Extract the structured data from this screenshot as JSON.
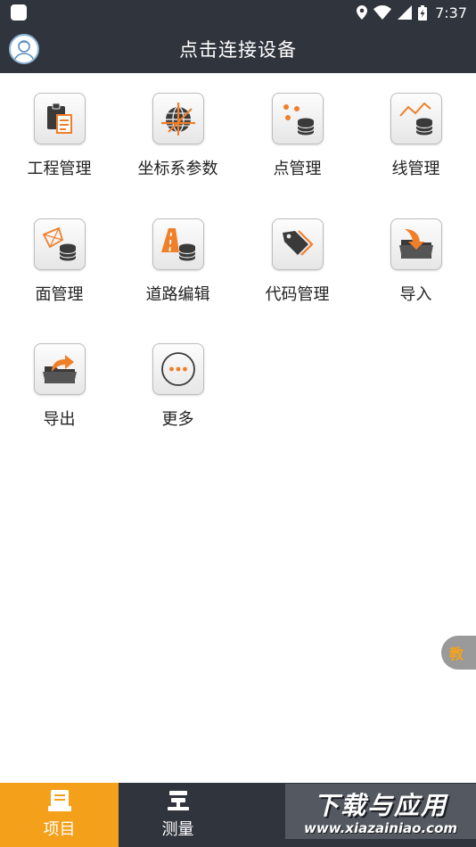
{
  "status_bar": {
    "time": "7:37",
    "icons": [
      "location-icon",
      "wifi-icon",
      "signal-icon",
      "battery-charging-icon"
    ]
  },
  "app_bar": {
    "title": "点击连接设备",
    "avatar_icon": "user-avatar-icon"
  },
  "grid": {
    "items": [
      {
        "label": "工程管理",
        "icon": "clipboard-document-icon"
      },
      {
        "label": "坐标系参数",
        "icon": "globe-axes-icon"
      },
      {
        "label": "点管理",
        "icon": "points-database-icon"
      },
      {
        "label": "线管理",
        "icon": "polyline-database-icon"
      },
      {
        "label": "面管理",
        "icon": "polygon-database-icon"
      },
      {
        "label": "道路编辑",
        "icon": "road-database-icon"
      },
      {
        "label": "代码管理",
        "icon": "tag-icon"
      },
      {
        "label": "导入",
        "icon": "folder-import-icon"
      },
      {
        "label": "导出",
        "icon": "folder-export-icon"
      },
      {
        "label": "更多",
        "icon": "more-dots-icon"
      }
    ]
  },
  "tutorial": {
    "label": "教"
  },
  "bottom_nav": {
    "items": [
      {
        "label": "项目",
        "icon": "project-icon",
        "active": true
      },
      {
        "label": "测量",
        "icon": "survey-receiver-icon",
        "active": false
      }
    ]
  },
  "watermark": {
    "cn": "下载与应用",
    "en": "www.xiazainiao.com"
  },
  "colors": {
    "bar_bg": "#2f343d",
    "accent": "#f5a01a",
    "icon_orange": "#f07f2a",
    "icon_dark": "#3a3a3a"
  }
}
